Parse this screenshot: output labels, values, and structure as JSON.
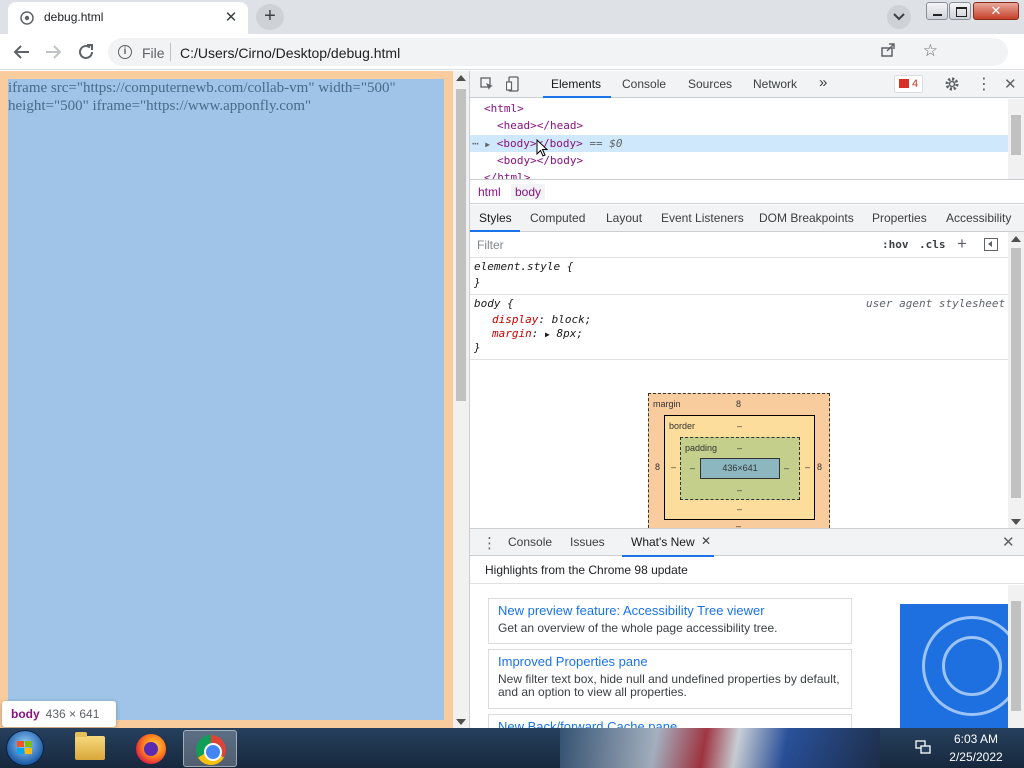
{
  "browser": {
    "tab_title": "debug.html",
    "tab_close": "✕",
    "new_tab": "+",
    "window_close": "✕",
    "scheme": "File",
    "url": "C:/Users/Cirno/Desktop/debug.html",
    "icons": [
      "back-arrow-icon",
      "forward-arrow-icon",
      "reload-icon",
      "info-icon",
      "share-icon",
      "star-icon",
      "profile-icon",
      "kebab-menu-icon"
    ]
  },
  "page": {
    "text": "iframe src=\"https://computernewb.com/collab-vm\" width=\"500\" height=\"500\" iframe=\"https://www.apponfly.com\"",
    "tooltip_tag": "body",
    "tooltip_dims": "436 × 641",
    "colors": {
      "margin": "#f9cc9d",
      "content": "#9fc4e7"
    }
  },
  "devtools": {
    "tabs": [
      "Elements",
      "Console",
      "Sources",
      "Network"
    ],
    "more_tabs": "»",
    "error_count": "4",
    "dom": {
      "html_open": "<html>",
      "head": "<head></head>",
      "body_selected": "<body></body>",
      "body_selected_suffix": "== $0",
      "body_second": "<body></body>",
      "html_close": "</html>"
    },
    "breadcrumb": [
      "html",
      "body"
    ],
    "sub_tabs": [
      "Styles",
      "Computed",
      "Layout",
      "Event Listeners",
      "DOM Breakpoints",
      "Properties",
      "Accessibility"
    ],
    "filter_placeholder": "Filter",
    "hov": ":hov",
    "cls": ".cls",
    "plus": "+",
    "styles": {
      "element_style": "element.style {",
      "element_close": "}",
      "body_selector": "body {",
      "ua_source": "user agent stylesheet",
      "prop1_name": "display",
      "prop1_value": "block;",
      "prop2_name": "margin",
      "prop2_value": "8px;",
      "body_close": "}"
    },
    "box_model": {
      "margin_label": "margin",
      "margin_top": "8",
      "margin_left": "8",
      "margin_right": "8",
      "margin_bottom": "–",
      "border_label": "border",
      "border_top": "–",
      "border_left": "–",
      "border_right": "–",
      "border_bottom": "–",
      "padding_label": "padding",
      "padding_top": "–",
      "padding_left": "–",
      "padding_right": "–",
      "padding_bottom": "–",
      "content": "436×641"
    },
    "drawer": {
      "tabs": [
        "Console",
        "Issues",
        "What's New"
      ],
      "tab_close": "✕",
      "close": "✕",
      "title": "Highlights from the Chrome 98 update",
      "cards": [
        {
          "heading": "New preview feature: Accessibility Tree viewer",
          "desc": "Get an overview of the whole page accessibility tree."
        },
        {
          "heading": "Improved Properties pane",
          "desc": "New filter text box, hide null and undefined properties by default, and an option to view all properties."
        },
        {
          "heading": "New Back/forward Cache pane",
          "desc": ""
        }
      ]
    }
  },
  "taskbar": {
    "time": "6:03 AM",
    "date": "2/25/2022",
    "apps": [
      "windows-explorer",
      "firefox",
      "chrome"
    ]
  }
}
